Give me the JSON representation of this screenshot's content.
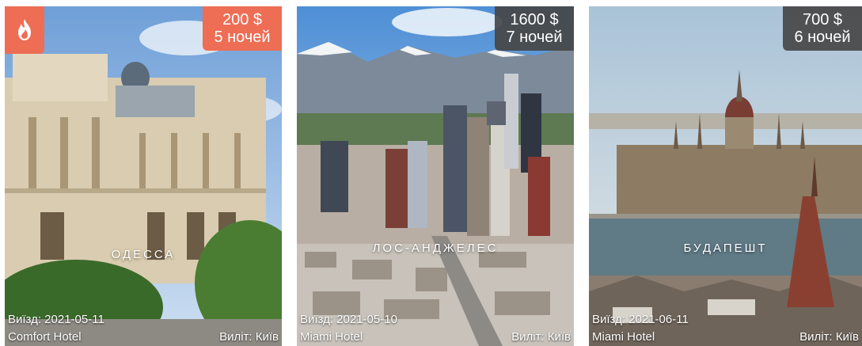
{
  "tours": [
    {
      "city": "ОДЕССА",
      "price": "200 $",
      "nights": "5 ночей",
      "departure": "Виїзд: 2021-05-11",
      "hotel": "Comfort Hotel",
      "from": "Виліт: Київ",
      "hot": true,
      "hot_icon": "fire-icon"
    },
    {
      "city": "ЛОС-АНДЖЕЛЕС",
      "price": "1600 $",
      "nights": "7 ночей",
      "departure": "Виїзд: 2021-05-10",
      "hotel": "Miami Hotel",
      "from": "Виліт: Київ",
      "hot": false
    },
    {
      "city": "БУДАПЕШТ",
      "price": "700 $",
      "nights": "6 ночей",
      "departure": "Виїзд: 2021-06-11",
      "hotel": "Miami Hotel",
      "from": "Виліт: Київ",
      "hot": false
    }
  ],
  "colors": {
    "hot_accent": "#ee6d55",
    "badge_dark": "#464646",
    "text": "#ffffff"
  }
}
